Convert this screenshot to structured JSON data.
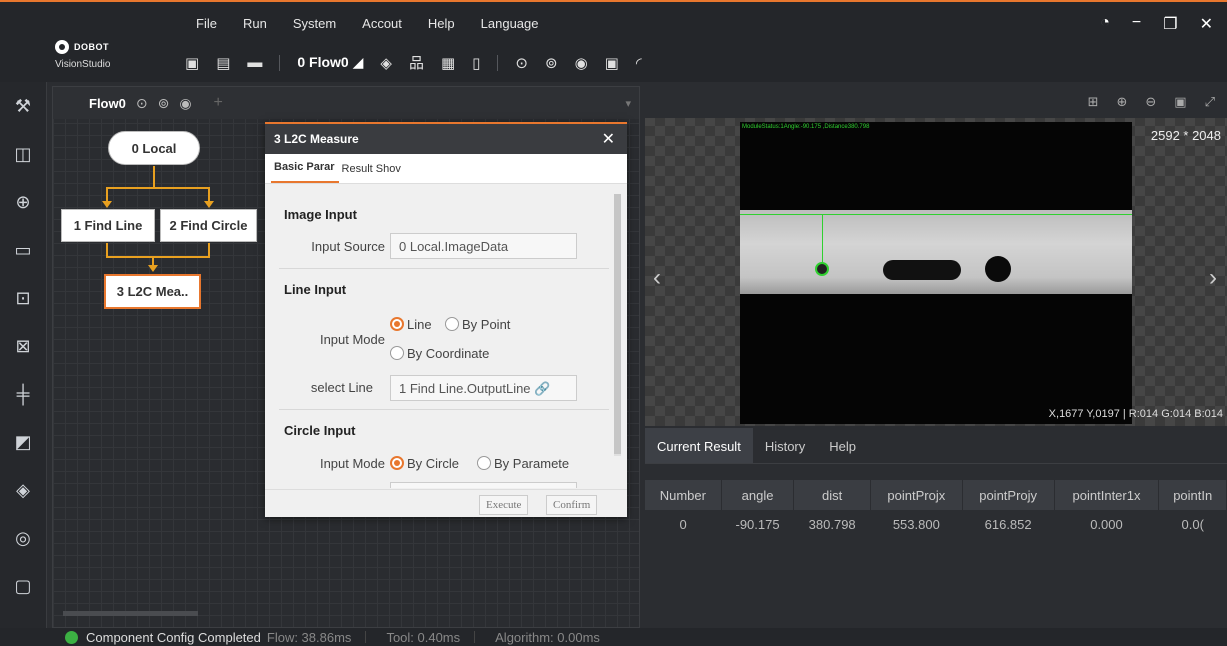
{
  "app": {
    "brand": "DOBOT",
    "name": "VisionStudio"
  },
  "menu": [
    "File",
    "Run",
    "System",
    "Accout",
    "Help",
    "Language"
  ],
  "toolbar": {
    "flow_select": "0 Flow0"
  },
  "flow": {
    "tab_label": "Flow0",
    "nodes": {
      "local": "0 Local",
      "find_line": "1 Find Line",
      "find_circle": "2 Find Circle",
      "l2c": "3 L2C Mea.."
    }
  },
  "dialog": {
    "title": "3 L2C Measure",
    "tabs": [
      "Basic Parar",
      "Result Shov"
    ],
    "image_input": {
      "section": "Image Input",
      "source_label": "Input Source",
      "source_value": "0 Local.ImageData"
    },
    "line_input": {
      "section": "Line Input",
      "mode_label": "Input Mode",
      "opt_line": "Line",
      "opt_point": "By Point",
      "opt_coord": "By Coordinate",
      "select_label": "select Line",
      "select_value": "1 Find Line.OutputLine"
    },
    "circle_input": {
      "section": "Circle Input",
      "mode_label": "Input Mode",
      "opt_circle": "By Circle",
      "opt_param": "By Paramete"
    },
    "buttons": {
      "execute": "Execute",
      "confirm": "Confirm"
    }
  },
  "viewer": {
    "status_text": "ModuleStatus:1Angle:-90.175 ,Distance380.798",
    "resolution": "2592 * 2048",
    "coords": "X,1677 Y,0197 | R:014 G:014 B:014"
  },
  "results": {
    "tabs": [
      "Current Result",
      "History",
      "Help"
    ],
    "columns": [
      "Number",
      "angle",
      "dist",
      "pointProjx",
      "pointProjy",
      "pointInter1x",
      "pointIn"
    ],
    "rows": [
      [
        "0",
        "-90.175",
        "380.798",
        "553.800",
        "616.852",
        "0.000",
        "0.0("
      ]
    ]
  },
  "statusbar": {
    "message": "Component Config Completed",
    "flow": "Flow: 38.86ms",
    "tool": "Tool: 0.40ms",
    "algorithm": "Algorithm: 0.00ms"
  },
  "colors": {
    "accent": "#e8772e",
    "overlay_green": "#30d030",
    "ok_green": "#3cb043"
  }
}
